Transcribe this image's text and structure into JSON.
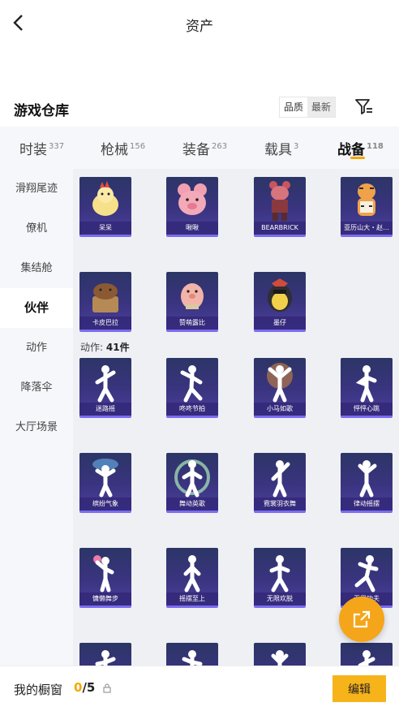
{
  "header": {
    "title": "资产"
  },
  "section": {
    "title": "游戏仓库"
  },
  "sort": {
    "options": [
      "品质",
      "最新"
    ]
  },
  "tabs": [
    {
      "label": "时装",
      "count": "337"
    },
    {
      "label": "枪械",
      "count": "156"
    },
    {
      "label": "装备",
      "count": "263"
    },
    {
      "label": "载具",
      "count": "3"
    },
    {
      "label": "战备",
      "count": "118",
      "active": true
    }
  ],
  "sidebar": {
    "items": [
      "滑翔尾迹",
      "僚机",
      "集结舱",
      "伙伴",
      "动作",
      "降落伞",
      "大厅场景"
    ],
    "active": "伙伴"
  },
  "partners": [
    "呆呆",
    "啾啾",
    "BEARBRICK",
    "亚历山大・赵...",
    "卡皮巴拉",
    "赞萌露比",
    "墨仔"
  ],
  "actions": {
    "label": "动作:",
    "count": "41件",
    "items": [
      "迷路摇",
      "咚咚节拍",
      "小马如歌",
      "怦怦心跳",
      "缤纷气象",
      "舞动英歌",
      "霓裳羽衣舞",
      "律动摇摆",
      "慵懒舞步",
      "摇摆至上",
      "无限欢脱",
      "无畏功夫"
    ]
  },
  "bottom": {
    "label": "我的橱窗",
    "current": "0",
    "total": "/5",
    "edit_label": "编辑"
  },
  "colors": {
    "accent": "#f5a800",
    "card_bg": "#3a3480",
    "card_border": "#7a6cf0"
  }
}
